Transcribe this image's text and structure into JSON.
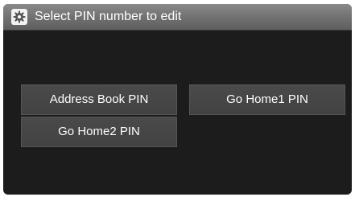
{
  "header": {
    "title": "Select PIN number to edit",
    "icon": "settings-gear-icon"
  },
  "buttons": {
    "address_book": "Address Book PIN",
    "go_home1": "Go Home1 PIN",
    "go_home2": "Go Home2 PIN"
  },
  "colors": {
    "background": "#1c1c1c",
    "header": "#747474",
    "button": "#454545",
    "text": "#ffffff"
  }
}
